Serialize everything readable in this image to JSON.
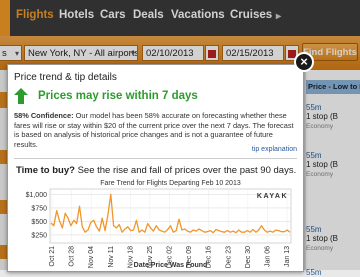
{
  "nav": {
    "tabs": [
      {
        "label": "Flights",
        "active": true
      },
      {
        "label": "Hotels"
      },
      {
        "label": "Cars"
      },
      {
        "label": "Deals"
      },
      {
        "label": "Vacations"
      },
      {
        "label": "Cruises"
      }
    ],
    "chevron": "▸"
  },
  "search": {
    "origin_suffix": "s",
    "destination": "New York, NY - All airports",
    "depart_date": "02/10/2013",
    "return_date": "02/15/2013",
    "find_button": "Find Flights"
  },
  "results": {
    "header": "Price - Low to High",
    "rows": [
      {
        "time": "55m",
        "stops": "1 stop (B",
        "cabin": "Economy"
      },
      {
        "time": "55m",
        "stops": "1 stop (B",
        "cabin": "Economy"
      },
      {
        "time": "",
        "stops": "",
        "cabin": ""
      },
      {
        "time": "55m",
        "stops": "1 stop (B",
        "cabin": "Economy"
      },
      {
        "time": "",
        "stops": "",
        "cabin": ""
      },
      {
        "time": "55m",
        "stops": "1 stop (B",
        "cabin": "Economy"
      }
    ]
  },
  "popup": {
    "title": "Price trend & tip details",
    "headline": "Prices may rise within 7 days",
    "confidence_label": "58% Confidence:",
    "body": "Our model has been 58% accurate on forecasting whether these fares will rise or stay within $20 of the current price over the next 7 days. The forecast is based on analysis of historical price changes and is not a guarantee of future results.",
    "tip_link": "tip explanation",
    "time_to_buy_bold": "Time to buy?",
    "time_to_buy_rest": " See the rise and fall of prices over the past 90 days.",
    "close_glyph": "×",
    "arrow_color": "#2e9b2e"
  },
  "chart_data": {
    "type": "line",
    "title": "Fare Trend for Flights Departing Feb 10 2013",
    "xlabel": "Date Price Was Found",
    "ylabel": "",
    "watermark": "KAYAK",
    "y_ticks": [
      "$1,000",
      "$750",
      "$500",
      "$250"
    ],
    "ylim": [
      100,
      1100
    ],
    "x_ticks": [
      "Oct 21",
      "Oct 28",
      "Nov 04",
      "Nov 11",
      "Nov 18",
      "Nov 25",
      "Dec 02",
      "Dec 09",
      "Dec 16",
      "Dec 23",
      "Dec 30",
      "Jan 06",
      "Jan 13"
    ],
    "grid": true,
    "series": [
      {
        "color": "#f0962a",
        "values": [
          470,
          420,
          700,
          510,
          380,
          650,
          560,
          420,
          520,
          460,
          780,
          400,
          300,
          340,
          480,
          520,
          400,
          320,
          560,
          330,
          620,
          1000,
          420,
          380,
          440,
          300,
          360,
          400,
          330,
          340,
          520,
          300,
          340,
          300,
          460,
          380,
          320,
          420,
          340,
          320,
          300,
          350,
          420,
          300,
          330,
          540,
          340,
          360,
          320,
          300,
          340,
          320,
          360,
          330,
          300,
          310,
          330,
          290,
          350,
          330,
          310,
          300,
          330,
          300,
          320,
          290,
          340,
          300,
          300,
          330,
          300,
          350,
          300,
          340,
          420,
          340,
          300,
          320,
          300,
          340,
          330,
          310,
          310,
          340,
          300
        ]
      }
    ]
  }
}
